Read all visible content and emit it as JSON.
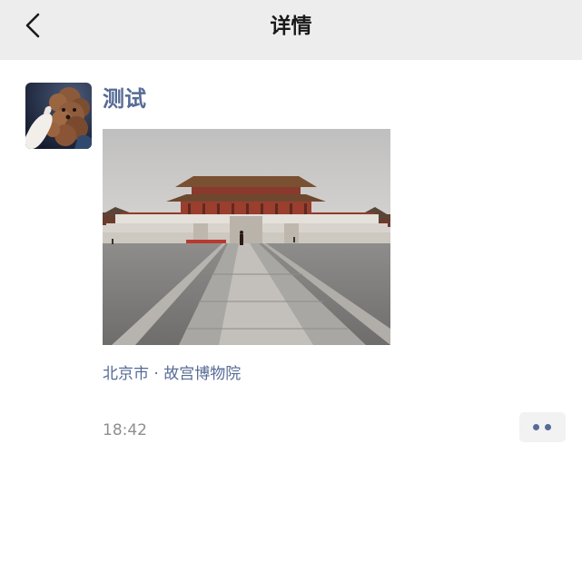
{
  "navbar": {
    "title": "详情",
    "back_icon": "chevron-left-icon"
  },
  "post": {
    "avatar_icon": "poodle-avatar",
    "username": "测试",
    "photo_subject": "forbidden-city-hall-photo",
    "location": "北京市 · 故宫博物院",
    "timestamp": "18:42",
    "more_icon": "two-dots-icon"
  },
  "colors": {
    "navbar_bg": "#ededed",
    "link_blue": "#576b95",
    "timestamp_gray": "#8f8f8f",
    "more_button_bg": "#f2f2f2"
  }
}
